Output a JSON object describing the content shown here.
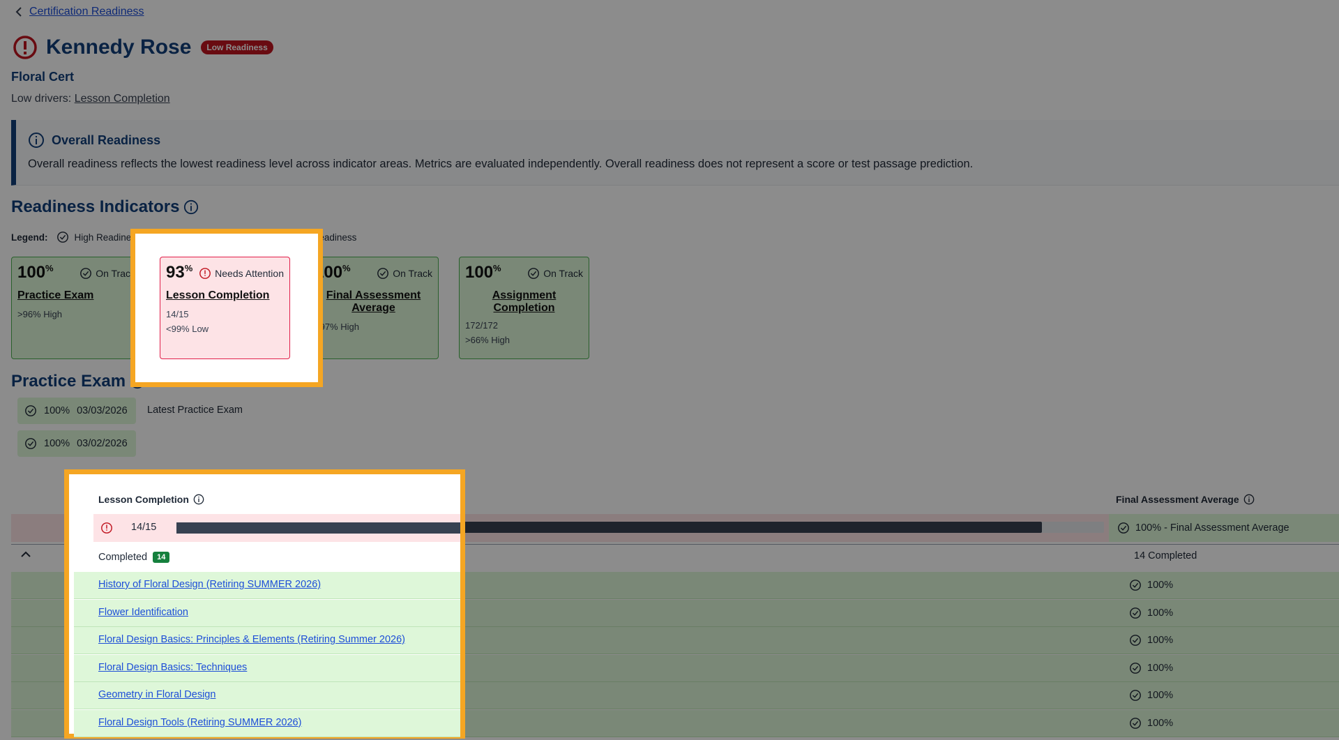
{
  "header": {
    "back_label": "Certification Readiness",
    "student_name": "Kennedy Rose",
    "readiness_badge": "Low Readiness",
    "cert_name": "Floral Cert",
    "drivers_prefix": "Low drivers:",
    "drivers_value": "Lesson Completion"
  },
  "overall": {
    "title": "Overall Readiness",
    "text": "Overall readiness reflects the lowest readiness level across indicator areas. Metrics are evaluated independently. Overall readiness does not represent a score or test passage prediction."
  },
  "indicators": {
    "title": "Readiness Indicators",
    "legend_label": "Legend:",
    "legend_high": "High Readines",
    "legend_low": "v Readiness",
    "cards": [
      {
        "pct": "100",
        "status": "On Track",
        "name": "Practice Exam",
        "sub1": ">96% High",
        "sub2": ""
      },
      {
        "pct": "93",
        "status": "Needs Attention",
        "name": "Lesson Completion",
        "sub1": "14/15",
        "sub2": "<99% Low"
      },
      {
        "pct": "100",
        "status": "On Track",
        "name": "Final Assessment Average",
        "sub1": ">97% High",
        "sub2": ""
      },
      {
        "pct": "100",
        "status": "On Track",
        "name": "Assignment Completion",
        "sub1": "172/172",
        "sub2": ">66% High"
      }
    ]
  },
  "practice": {
    "title": "Practice Exam",
    "attempts": [
      {
        "score": "100%",
        "date": "03/03/2026",
        "note": "Latest Practice Exam"
      },
      {
        "score": "100%",
        "date": "03/02/2026",
        "note": ""
      }
    ]
  },
  "table": {
    "col_lesson": "Lesson Completion",
    "col_final": "Final Assessment Average",
    "progress_label": "14/15",
    "progress_fraction": 0.9333,
    "final_summary": "100% - Final Assessment Average",
    "completed_label": "Completed",
    "completed_count": "14",
    "completed_right": "14 Completed",
    "lessons": [
      {
        "name": "History of Floral Design (Retiring SUMMER 2026)",
        "score": "100%"
      },
      {
        "name": "Flower Identification",
        "score": "100%"
      },
      {
        "name": "Floral Design Basics: Principles & Elements (Retiring Summer 2026)",
        "score": "100%"
      },
      {
        "name": "Floral Design Basics: Techniques",
        "score": "100%"
      },
      {
        "name": "Geometry in Floral Design",
        "score": "100%"
      },
      {
        "name": "Floral Design Tools (Retiring SUMMER 2026)",
        "score": "100%"
      }
    ]
  },
  "colors": {
    "navy": "#123f7a",
    "success": "#def7d9",
    "danger": "#c0141f",
    "highlight": "#f5a623"
  }
}
